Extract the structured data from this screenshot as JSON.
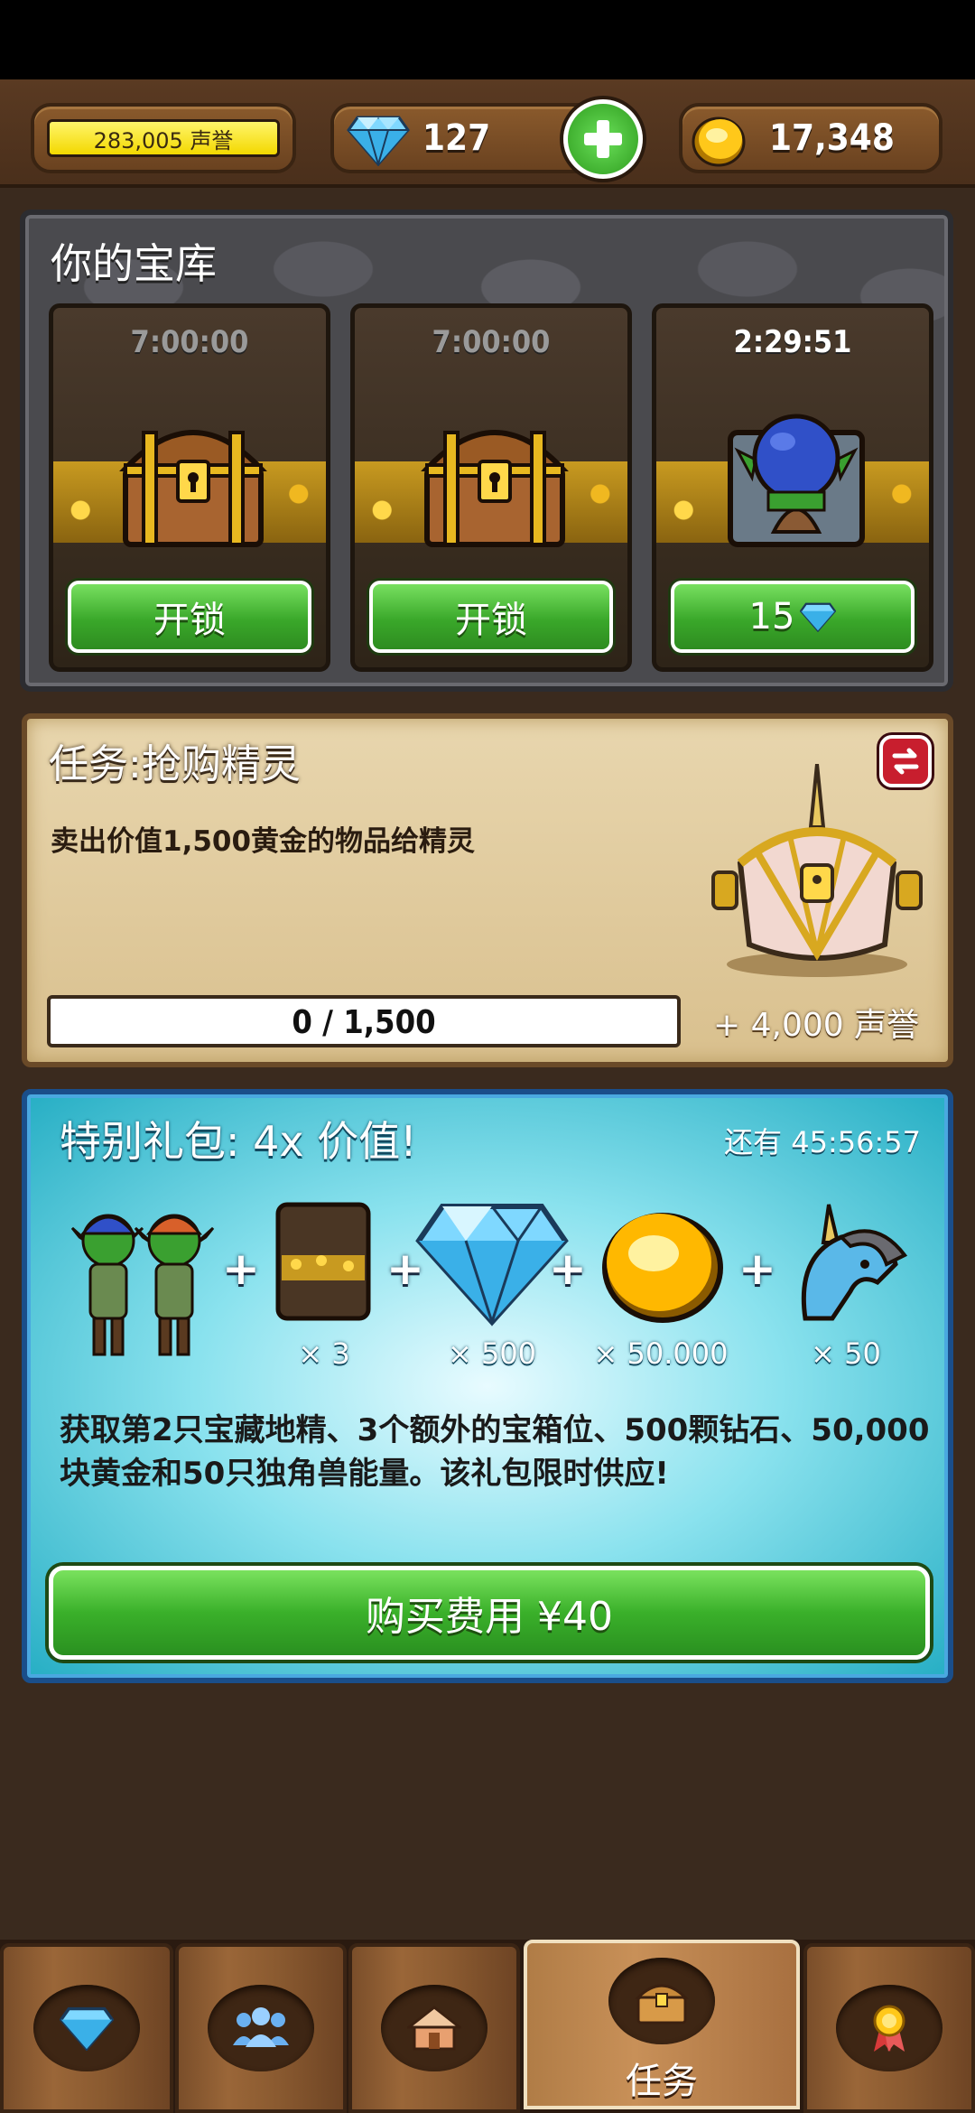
{
  "header": {
    "reputation": "283,005 声誉",
    "gems": "127",
    "gold": "17,348"
  },
  "vault": {
    "title": "你的宝库",
    "slots": [
      {
        "timer": "7:00:00",
        "button": "开锁",
        "icon": "treasure-chest"
      },
      {
        "timer": "7:00:00",
        "button": "开锁",
        "icon": "treasure-chest"
      },
      {
        "timer": "2:29:51",
        "button": "15",
        "button_icon": "diamond-icon",
        "icon": "goblin-opening-chest"
      }
    ]
  },
  "task": {
    "title": "任务:抢购精灵",
    "description": "卖出价值1,500黄金的物品给精灵",
    "progress_text": "0 / 1,500",
    "progress_current": 0,
    "progress_total": 1500,
    "reward": "+ 4,000 声誉"
  },
  "offer": {
    "title": "特别礼包: 4x 价值!",
    "timer": "还有 45:56:57",
    "items": [
      {
        "icon": "twin-goblins",
        "qty": ""
      },
      {
        "icon": "chest-slot",
        "qty": "× 3"
      },
      {
        "icon": "diamond",
        "qty": "× 500"
      },
      {
        "icon": "gold-coin",
        "qty": "× 50.000"
      },
      {
        "icon": "unicorn",
        "qty": "× 50"
      }
    ],
    "description": "获取第2只宝藏地精、3个额外的宝箱位、500颗钻石、50,000块黄金和50只独角兽能量。该礼包限时供应!",
    "buy_button": "购买费用 ¥40"
  },
  "nav": {
    "tabs": [
      {
        "icon": "diamond-icon",
        "label": ""
      },
      {
        "icon": "people-icon",
        "label": ""
      },
      {
        "icon": "house-icon",
        "label": ""
      },
      {
        "icon": "chest-icon",
        "label": "任务",
        "active": true
      },
      {
        "icon": "medal-icon",
        "label": ""
      }
    ]
  },
  "colors": {
    "wood": "#5a3a22",
    "green_button": "#3aa82a",
    "offer_blue": "#26aec4",
    "parchment": "#e8d6ae"
  }
}
